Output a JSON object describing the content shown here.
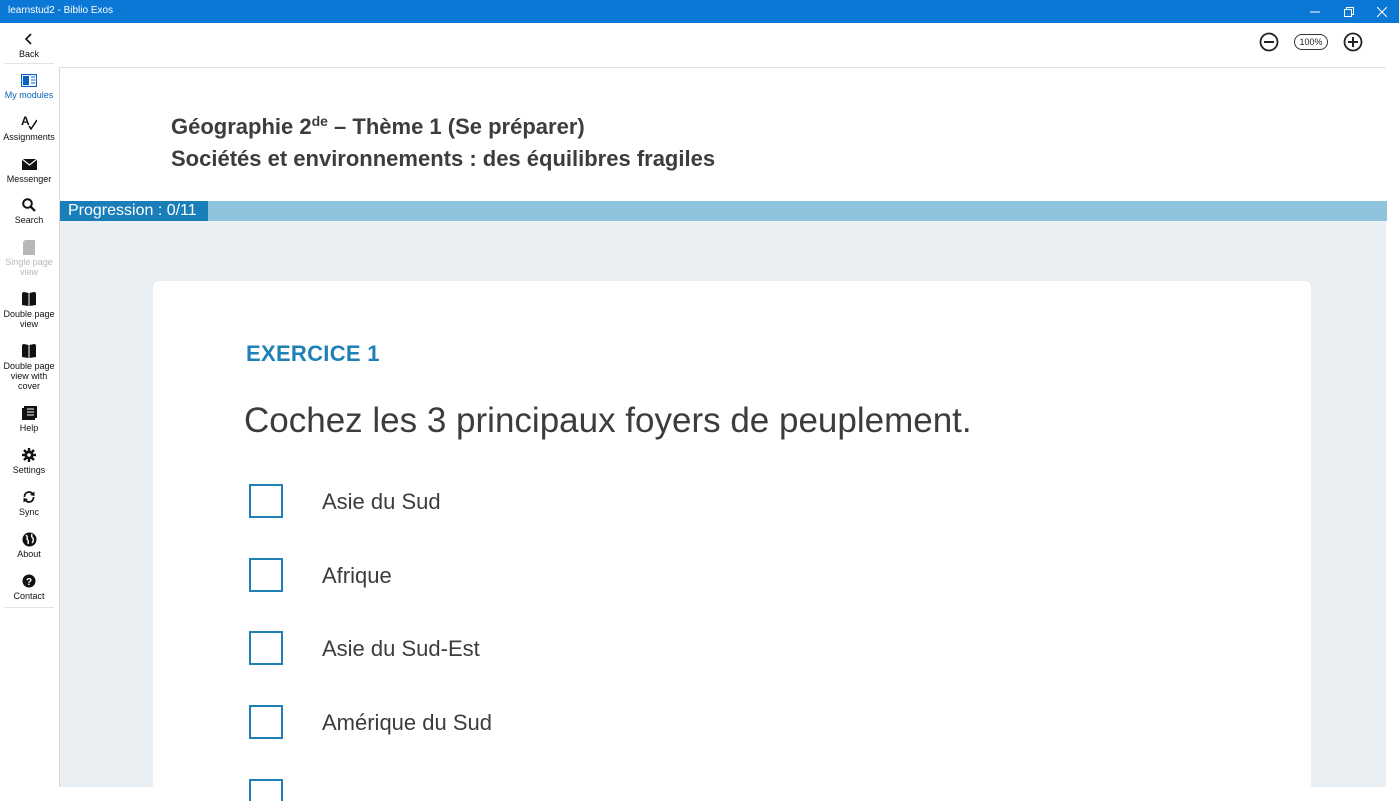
{
  "window": {
    "title": "learnstud2 - Biblio Exos"
  },
  "sidebar": {
    "items": [
      {
        "label": "Back",
        "icon": "back-arrow-icon"
      },
      {
        "label": "My modules",
        "icon": "modules-icon"
      },
      {
        "label": "Assignments",
        "icon": "assignments-icon"
      },
      {
        "label": "Messenger",
        "icon": "envelope-icon"
      },
      {
        "label": "Search",
        "icon": "search-icon"
      },
      {
        "label": "Single page view",
        "icon": "single-page-icon"
      },
      {
        "label": "Double page view",
        "icon": "double-page-icon"
      },
      {
        "label": "Double page view with cover",
        "icon": "double-page-cover-icon"
      },
      {
        "label": "Help",
        "icon": "help-book-icon"
      },
      {
        "label": "Settings",
        "icon": "gear-icon"
      },
      {
        "label": "Sync",
        "icon": "sync-icon"
      },
      {
        "label": "About",
        "icon": "globe-icon"
      },
      {
        "label": "Contact",
        "icon": "question-icon"
      }
    ]
  },
  "zoom": {
    "level": "100%"
  },
  "header": {
    "title_main": "Géographie 2",
    "title_sup": "de",
    "title_rest": " – Thème 1 (Se préparer)",
    "subtitle": "Sociétés et environnements : des équilibres fragiles"
  },
  "progress": {
    "label": "Progression : 0/11",
    "completed": 0,
    "total": 11
  },
  "exercise": {
    "title": "EXERCICE 1",
    "question": "Cochez les 3 principaux foyers de peuplement.",
    "options": [
      {
        "label": "Asie du Sud",
        "checked": false
      },
      {
        "label": "Afrique",
        "checked": false
      },
      {
        "label": "Asie du Sud-Est",
        "checked": false
      },
      {
        "label": "Amérique du Sud",
        "checked": false
      }
    ]
  },
  "colors": {
    "titlebar": "#0a78d4",
    "accent": "#1f80b8",
    "progress_track": "#8fc2dc",
    "page_bg": "#e9eff2"
  }
}
